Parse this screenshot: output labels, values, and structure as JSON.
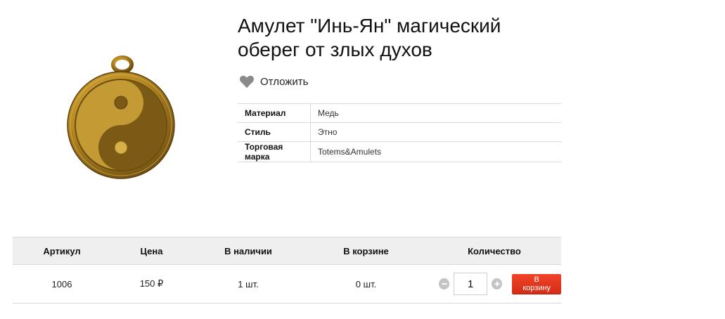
{
  "product": {
    "title_line1": "Амулет \"Инь-Ян\" магический",
    "title_line2": "оберег от злых духов",
    "image_icon": "yin-yang-amulet-icon",
    "wishlist_label": "Отложить",
    "wishlist_icon": "heart-icon"
  },
  "properties": [
    {
      "name": "Материал",
      "value": "Медь"
    },
    {
      "name": "Стиль",
      "value": "Этно"
    },
    {
      "name": "Торговая марка",
      "value": "Totems&Amulets"
    }
  ],
  "offers": {
    "headers": {
      "article": "Артикул",
      "price": "Цена",
      "stock": "В наличии",
      "in_cart": "В корзине",
      "quantity": "Количество"
    },
    "row": {
      "article": "1006",
      "price": "150 ₽",
      "stock": "1 шт.",
      "in_cart": "0 шт.",
      "quantity": "1"
    },
    "buy_label": "В корзину",
    "minus_icon": "minus-icon",
    "plus_icon": "plus-icon"
  },
  "colors": {
    "buy_button": "#e33a1f",
    "header_bg": "#efefef",
    "border": "#d9d9d9",
    "heart": "#8a8a8a"
  }
}
